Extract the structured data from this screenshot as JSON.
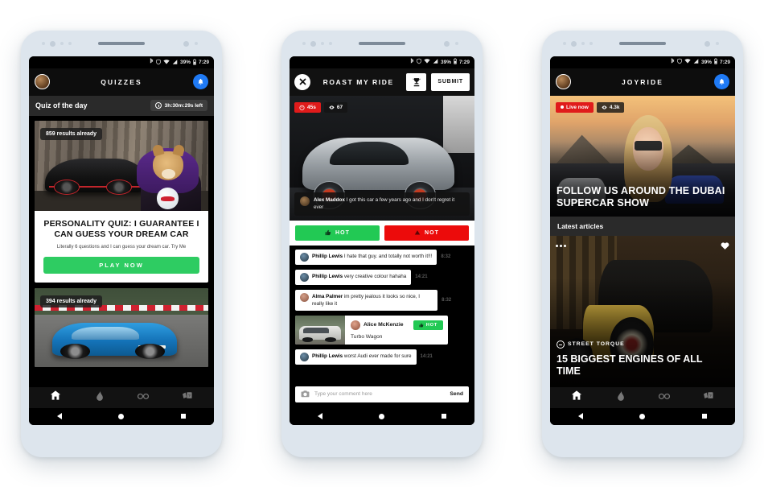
{
  "status_bar": {
    "battery_percent": "39%",
    "time": "7:29",
    "icons": [
      "bluetooth-icon",
      "shield-icon",
      "wifi-icon",
      "signal-icon",
      "battery-icon"
    ]
  },
  "phone1": {
    "header": {
      "title": "QUIZZES",
      "avatar": "user-avatar",
      "bell": "notification-bell-icon"
    },
    "quiz_of_day": {
      "label": "Quiz of the day",
      "timer": "3h:30m:29s left",
      "timer_icon": "clock-icon"
    },
    "cards": [
      {
        "results_badge": "859 results already",
        "title": "PERSONALITY QUIZ: I GUARANTEE I CAN GUESS YOUR DREAM CAR",
        "subtitle": "Literally 6 questions and I can guess your dream car. Try Me",
        "cta": "PLAY NOW"
      },
      {
        "results_badge": "394 results already"
      }
    ],
    "bottom_nav": [
      {
        "icon": "home-icon",
        "active": true
      },
      {
        "icon": "flame-icon",
        "active": false
      },
      {
        "icon": "binoculars-icon",
        "active": false
      },
      {
        "icon": "quiz-cards-icon",
        "active": false
      }
    ],
    "android_nav": [
      "back-button",
      "home-button",
      "recents-button"
    ]
  },
  "phone2": {
    "header": {
      "close": "close-icon",
      "title": "ROAST MY RIDE",
      "trophy": "trophy-icon",
      "submit": "SUBMIT"
    },
    "badges": {
      "timer": "45s",
      "views": "67",
      "timer_icon": "timer-icon",
      "views_icon": "eye-icon"
    },
    "owner_comment": {
      "author": "Alex Maddox",
      "text": "I got this car a few years ago and I don't regret it ever"
    },
    "vote_buttons": [
      {
        "label": "HOT",
        "icon": "thumbs-up-icon",
        "color": "#22c954"
      },
      {
        "label": "NOT",
        "icon": "thumbs-down-icon",
        "color": "#ec0b0b"
      }
    ],
    "messages": [
      {
        "author": "Phillip Lewis",
        "text": "I hate that guy. and totally not worth it!!!",
        "time": "8:32"
      },
      {
        "author": "Phillip Lewis",
        "text": "very creative colour hahaha",
        "time": "14:21"
      },
      {
        "author": "Alma Palmer",
        "text": "im pretty jealous it looks so nice, I really like it",
        "time": "8:32"
      }
    ],
    "ride_card": {
      "author": "Alice McKenzie",
      "caption": "Turbo Wagon",
      "badge": "HOT"
    },
    "last_message": {
      "author": "Phillip Lewis",
      "text": "worst Audi ever made for sure",
      "time": "14:21"
    },
    "composer": {
      "placeholder": "Type your comment here",
      "send": "Send",
      "camera_icon": "camera-icon"
    }
  },
  "phone3": {
    "header": {
      "title": "JOYRIDE",
      "avatar": "user-avatar",
      "bell": "notification-bell-icon"
    },
    "hero": {
      "live_badge": "Live now",
      "views": "4.3k",
      "views_icon": "eye-icon",
      "title": "FOLLOW US AROUND THE DUBAI SUPERCAR SHOW"
    },
    "section_label": "Latest articles",
    "article": {
      "tag": "STREET TORQUE",
      "tag_icon": "street-torque-icon",
      "title": "15 BIGGEST ENGINES OF ALL TIME",
      "more_icon": "more-options-icon",
      "favorite_icon": "heart-icon"
    },
    "bottom_nav": [
      {
        "icon": "home-icon",
        "active": true
      },
      {
        "icon": "flame-icon",
        "active": false
      },
      {
        "icon": "binoculars-icon",
        "active": false
      },
      {
        "icon": "quiz-cards-icon",
        "active": false
      }
    ]
  },
  "colors": {
    "accent_green": "#22c954",
    "accent_red": "#ec0b0b",
    "accent_blue": "#1f7af5",
    "live_red": "#e01b1b",
    "phone_frame": "#dde5ed"
  }
}
